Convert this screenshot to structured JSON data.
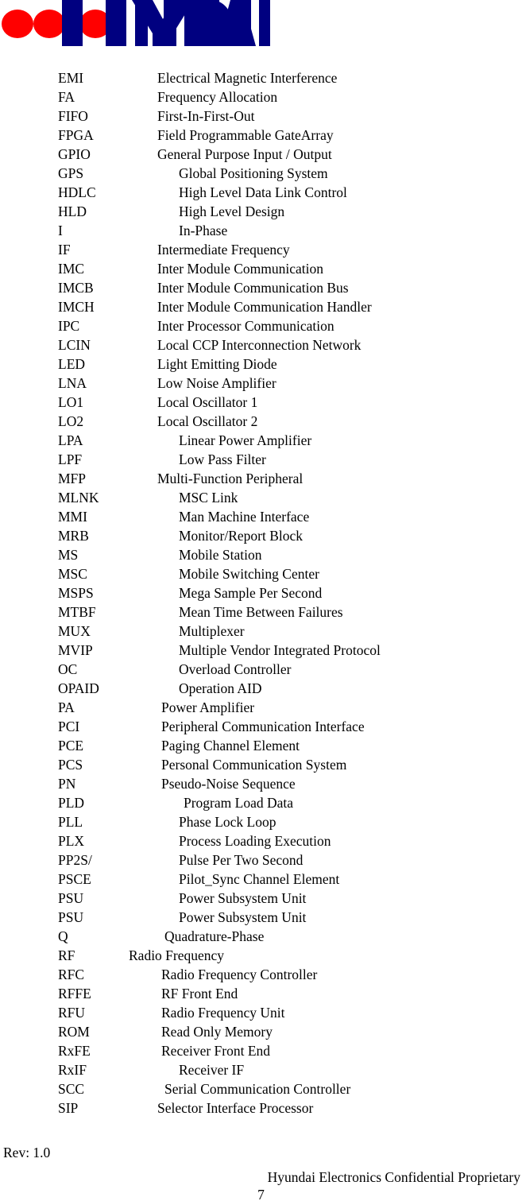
{
  "header": {
    "logo_text": "HYUNDAI",
    "logo_navy": "#000080",
    "logo_red": "#FF0000"
  },
  "abbreviations": {
    "rows": [
      {
        "term": "EMI",
        "definition": "Electrical Magnetic Interference",
        "indent": 1
      },
      {
        "term": "FA",
        "definition": "Frequency Allocation",
        "indent": 1
      },
      {
        "term": "FIFO",
        "definition": "First-In-First-Out",
        "indent": 1
      },
      {
        "term": "FPGA",
        "definition": "Field Programmable GateArray",
        "indent": 1
      },
      {
        "term": "GPIO",
        "definition": "General Purpose Input / Output",
        "indent": 1
      },
      {
        "term": "GPS",
        "definition": "Global Positioning System",
        "indent": 4
      },
      {
        "term": "HDLC",
        "definition": "High Level Data Link Control",
        "indent": 4
      },
      {
        "term": "HLD",
        "definition": "High Level Design",
        "indent": 4
      },
      {
        "term": "I",
        "definition": "In-Phase",
        "indent": 4
      },
      {
        "term": "IF",
        "definition": "Intermediate Frequency",
        "indent": 1
      },
      {
        "term": "IMC",
        "definition": "Inter Module Communication",
        "indent": 1
      },
      {
        "term": "IMCB",
        "definition": "Inter Module Communication Bus",
        "indent": 1
      },
      {
        "term": "IMCH",
        "definition": "Inter Module Communication Handler",
        "indent": 1
      },
      {
        "term": "IPC",
        "definition": "Inter Processor Communication",
        "indent": 1
      },
      {
        "term": "LCIN",
        "definition": "Local CCP Interconnection Network",
        "indent": 1
      },
      {
        "term": "LED",
        "definition": "Light Emitting Diode",
        "indent": 1
      },
      {
        "term": "LNA",
        "definition": "Low Noise Amplifier",
        "indent": 1
      },
      {
        "term": "LO1",
        "definition": "Local Oscillator 1",
        "indent": 1
      },
      {
        "term": "LO2",
        "definition": "Local Oscillator 2",
        "indent": 1
      },
      {
        "term": "LPA",
        "definition": "Linear Power Amplifier",
        "indent": 4
      },
      {
        "term": "LPF",
        "definition": "Low Pass Filter",
        "indent": 4
      },
      {
        "term": "MFP",
        "definition": "Multi-Function Peripheral",
        "indent": 1
      },
      {
        "term": "MLNK",
        "definition": "MSC Link",
        "indent": 4
      },
      {
        "term": "MMI",
        "definition": "Man Machine Interface",
        "indent": 4
      },
      {
        "term": "MRB",
        "definition": "Monitor/Report Block",
        "indent": 4
      },
      {
        "term": "MS",
        "definition": "Mobile Station",
        "indent": 4
      },
      {
        "term": "MSC",
        "definition": "Mobile Switching Center",
        "indent": 4
      },
      {
        "term": "MSPS",
        "definition": "Mega Sample Per Second",
        "indent": 4
      },
      {
        "term": "MTBF",
        "definition": "Mean Time Between Failures",
        "indent": 4
      },
      {
        "term": "MUX",
        "definition": "Multiplexer",
        "indent": 4
      },
      {
        "term": "MVIP",
        "definition": "Multiple Vendor Integrated Protocol",
        "indent": 4
      },
      {
        "term": "OC",
        "definition": "Overload Controller",
        "indent": 4
      },
      {
        "term": "OPAID",
        "definition": "Operation AID",
        "indent": 4
      },
      {
        "term": "PA",
        "definition": "Power Amplifier",
        "indent": 2
      },
      {
        "term": "PCI",
        "definition": "Peripheral Communication Interface",
        "indent": 2
      },
      {
        "term": "PCE",
        "definition": "Paging Channel Element",
        "indent": 2
      },
      {
        "term": "PCS",
        "definition": "Personal Communication System",
        "indent": 2
      },
      {
        "term": "PN",
        "definition": "Pseudo-Noise Sequence",
        "indent": 2
      },
      {
        "term": "PLD",
        "definition": "Program Load Data",
        "indent": 5
      },
      {
        "term": "PLL",
        "definition": "Phase Lock Loop",
        "indent": 4
      },
      {
        "term": "PLX",
        "definition": "Process Loading Execution",
        "indent": 4
      },
      {
        "term": "PP2S/",
        "definition": "Pulse Per Two Second",
        "indent": 4
      },
      {
        "term": "PSCE",
        "definition": "Pilot_Sync Channel Element",
        "indent": 4
      },
      {
        "term": "PSU",
        "definition": "Power Subsystem Unit",
        "indent": 4
      },
      {
        "term": "PSU",
        "definition": "Power Subsystem Unit",
        "indent": 4
      },
      {
        "term": "Q",
        "definition": "Quadrature-Phase",
        "indent": 3
      },
      {
        "term": "RF",
        "definition": "Radio Frequency",
        "indent": 0
      },
      {
        "term": "RFC",
        "definition": "Radio Frequency Controller",
        "indent": 2
      },
      {
        "term": "RFFE",
        "definition": "RF Front End",
        "indent": 2
      },
      {
        "term": "RFU",
        "definition": "Radio Frequency Unit",
        "indent": 2
      },
      {
        "term": "ROM",
        "definition": "Read Only Memory",
        "indent": 2
      },
      {
        "term": "RxFE",
        "definition": "Receiver Front End",
        "indent": 2
      },
      {
        "term": "RxIF",
        "definition": "Receiver IF",
        "indent": 4
      },
      {
        "term": "SCC",
        "definition": "Serial Communication Controller",
        "indent": 3
      },
      {
        "term": "SIP",
        "definition": "Selector Interface Processor",
        "indent": 1
      }
    ]
  },
  "footer": {
    "revision": "Rev: 1.0",
    "confidential": "Hyundai Electronics Confidential Proprietary",
    "page_number": "7"
  }
}
